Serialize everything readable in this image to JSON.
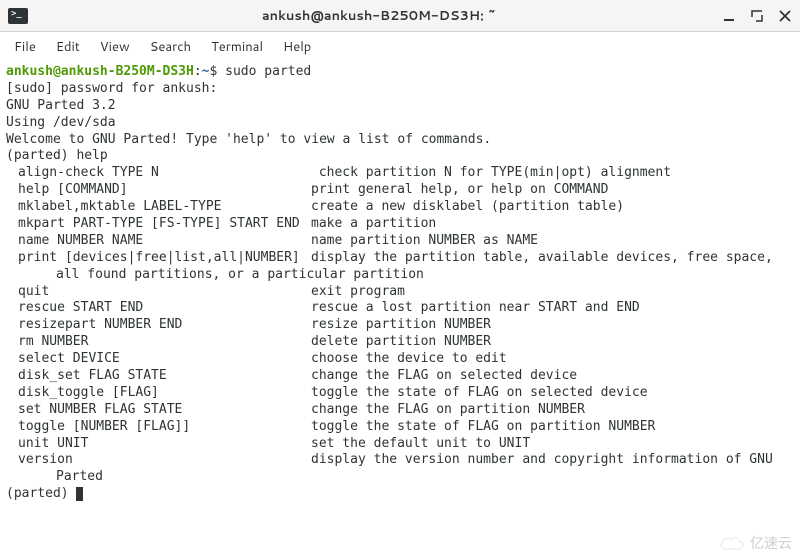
{
  "titlebar": {
    "title": "ankush@ankush-B250M-DS3H: ~"
  },
  "menu": {
    "file": "File",
    "edit": "Edit",
    "view": "View",
    "search": "Search",
    "terminal": "Terminal",
    "help": "Help"
  },
  "prompt": {
    "userhost": "ankush@ankush-B250M-DS3H",
    "colon": ":",
    "path": "~",
    "dollar": "$ ",
    "command": "sudo parted"
  },
  "lines": {
    "sudo": "[sudo] password for ankush:",
    "gnu": "GNU Parted 3.2",
    "using": "Using /dev/sda",
    "welcome": "Welcome to GNU Parted! Type 'help' to view a list of commands.",
    "parted_help": "(parted) help",
    "print_wrap": "all found partitions, or a particular partition",
    "version_wrap": "Parted",
    "parted_prompt": "(parted) "
  },
  "help": [
    {
      "cmd": "align-check TYPE N",
      "desc": " check partition N for TYPE(min|opt) alignment"
    },
    {
      "cmd": "help [COMMAND]",
      "desc": "print general help, or help on COMMAND"
    },
    {
      "cmd": "mklabel,mktable LABEL-TYPE",
      "desc": "create a new disklabel (partition table)"
    },
    {
      "cmd": "mkpart PART-TYPE [FS-TYPE] START END",
      "desc": "make a partition"
    },
    {
      "cmd": "name NUMBER NAME",
      "desc": "name partition NUMBER as NAME"
    },
    {
      "cmd": "print [devices|free|list,all|NUMBER]",
      "desc": "display the partition table, available devices, free space,"
    },
    {
      "cmd": "quit",
      "desc": "exit program"
    },
    {
      "cmd": "rescue START END",
      "desc": "rescue a lost partition near START and END"
    },
    {
      "cmd": "resizepart NUMBER END",
      "desc": "resize partition NUMBER"
    },
    {
      "cmd": "rm NUMBER",
      "desc": "delete partition NUMBER"
    },
    {
      "cmd": "select DEVICE",
      "desc": "choose the device to edit"
    },
    {
      "cmd": "disk_set FLAG STATE",
      "desc": "change the FLAG on selected device"
    },
    {
      "cmd": "disk_toggle [FLAG]",
      "desc": "toggle the state of FLAG on selected device"
    },
    {
      "cmd": "set NUMBER FLAG STATE",
      "desc": "change the FLAG on partition NUMBER"
    },
    {
      "cmd": "toggle [NUMBER [FLAG]]",
      "desc": "toggle the state of FLAG on partition NUMBER"
    },
    {
      "cmd": "unit UNIT",
      "desc": "set the default unit to UNIT"
    },
    {
      "cmd": "version",
      "desc": "display the version number and copyright information of GNU"
    }
  ],
  "watermark": "亿速云"
}
